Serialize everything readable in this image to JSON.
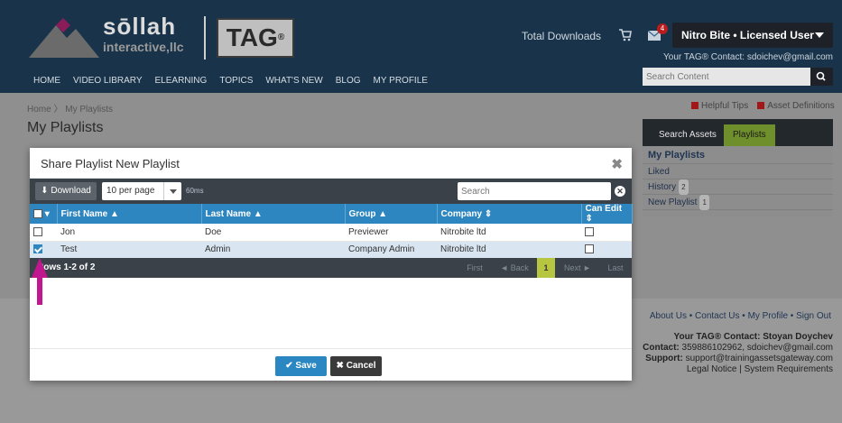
{
  "brand": {
    "name": "sōllah",
    "sub": "interactive,llc",
    "tag": "TAG"
  },
  "header": {
    "total_downloads": "Total Downloads",
    "mail_count": "4",
    "user": "Nitro Bite • Licensed User",
    "contact": "Your TAG® Contact: sdoichev@gmail.com",
    "search_placeholder": "Search Content"
  },
  "nav": [
    "HOME",
    "VIDEO LIBRARY",
    "ELEARNING",
    "TOPICS",
    "WHAT'S NEW",
    "BLOG",
    "MY PROFILE"
  ],
  "breadcrumb": {
    "home": "Home",
    "sep": "〉",
    "current": "My Playlists"
  },
  "page_title": "My Playlists",
  "helpful": {
    "tips": "Helpful Tips",
    "defs": "Asset Definitions"
  },
  "side": {
    "tabs": [
      "Search Assets",
      "Playlists"
    ],
    "header": "My Playlists",
    "items": [
      {
        "label": "Liked",
        "count": ""
      },
      {
        "label": "History",
        "count": "2"
      },
      {
        "label": "New Playlist",
        "count": "1"
      }
    ]
  },
  "footer": {
    "links": "About Us • Contact Us • My Profile • Sign Out",
    "contact_name": "Your TAG® Contact: Stoyan Doychev",
    "contact_label": "Contact:",
    "contact_value": "359886102962, sdoichev@gmail.com",
    "support_label": "Support:",
    "support_value": "support@trainingassetsgateway.com",
    "legal": "Legal Notice | System Requirements"
  },
  "modal": {
    "title": "Share Playlist New Playlist",
    "download": "Download",
    "per_page": "10 per page",
    "timing": "60ms",
    "search_placeholder": "Search",
    "columns": [
      "First Name",
      "Last Name",
      "Group",
      "Company",
      "Can Edit"
    ],
    "rows": [
      {
        "first": "Jon",
        "last": "Doe",
        "group": "Previewer",
        "company": "Nitrobite ltd",
        "selected": false
      },
      {
        "first": "Test",
        "last": "Admin",
        "group": "Company Admin",
        "company": "Nitrobite ltd",
        "selected": true
      }
    ],
    "rows_info": "Rows 1-2 of 2",
    "pager": {
      "first": "First",
      "back": "◄ Back",
      "page": "1",
      "next": "Next ►",
      "last": "Last"
    },
    "save": "Save",
    "cancel": "Cancel"
  },
  "colors": {
    "header": "#2e5f88",
    "table_header": "#2d86bf",
    "accent_green": "#b6c640",
    "arrow": "#c0168e"
  }
}
